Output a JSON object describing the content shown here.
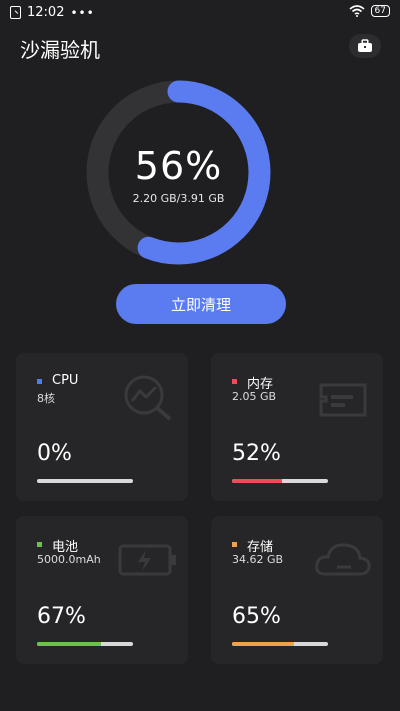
{
  "status_bar": {
    "time": "12:02",
    "dots": "•••",
    "battery": "67"
  },
  "app": {
    "title": "沙漏验机"
  },
  "memory_ring": {
    "percent_text": "56%",
    "usage_text": "2.20 GB/3.91 GB",
    "fraction": 0.56,
    "color": "#5b7cf1"
  },
  "clean_button": {
    "label": "立即清理"
  },
  "cards": {
    "cpu": {
      "name": "CPU",
      "sub": "8核",
      "percent_text": "0%",
      "fraction": 0.0,
      "color": "#4a7ff0"
    },
    "memory": {
      "name": "内存",
      "sub": "2.05 GB",
      "percent_text": "52%",
      "fraction": 0.52,
      "color": "#f04a5b"
    },
    "battery": {
      "name": "电池",
      "sub": "5000.0mAh",
      "percent_text": "67%",
      "fraction": 0.67,
      "color": "#6cc24a"
    },
    "storage": {
      "name": "存储",
      "sub": "34.62 GB",
      "percent_text": "65%",
      "fraction": 0.65,
      "color": "#f0a24a"
    }
  },
  "icons": [
    "sim-icon",
    "wifi-icon",
    "battery-icon",
    "toolbox-icon",
    "chart-search-icon",
    "memory-card-icon",
    "battery-charging-icon",
    "cloud-icon"
  ]
}
